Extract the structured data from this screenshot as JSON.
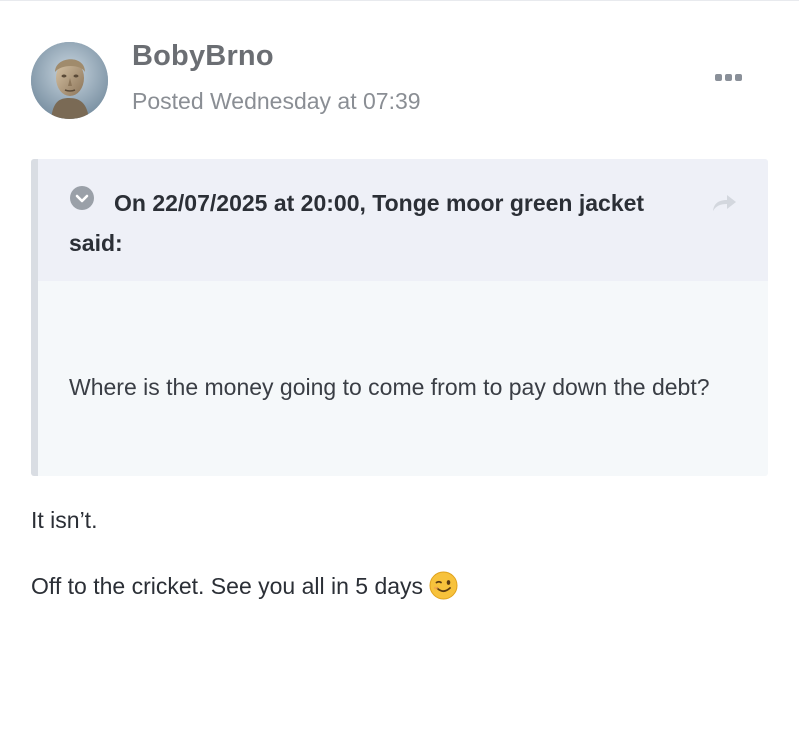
{
  "post": {
    "author": "BobyBrno",
    "posted": "Posted Wednesday at 07:39",
    "quote": {
      "citation": "On 22/07/2025 at 20:00, Tonge moor green jacket said:",
      "body": "Where is the money going to come from to pay down the debt?"
    },
    "lines": [
      "It isn’t.",
      "Off to the cricket. See you all in 5 days"
    ],
    "emoji": "winking-face",
    "icons": {
      "menu": "more-options-icon",
      "toggle": "chevron-down-circle-icon",
      "share": "share-arrow-icon"
    },
    "colors": {
      "quote_header_bg": "#eef0f7",
      "quote_body_bg": "#f5f8fa",
      "quote_border": "#d9dde3",
      "author": "#6b6e73",
      "meta": "#8a8e94"
    }
  }
}
